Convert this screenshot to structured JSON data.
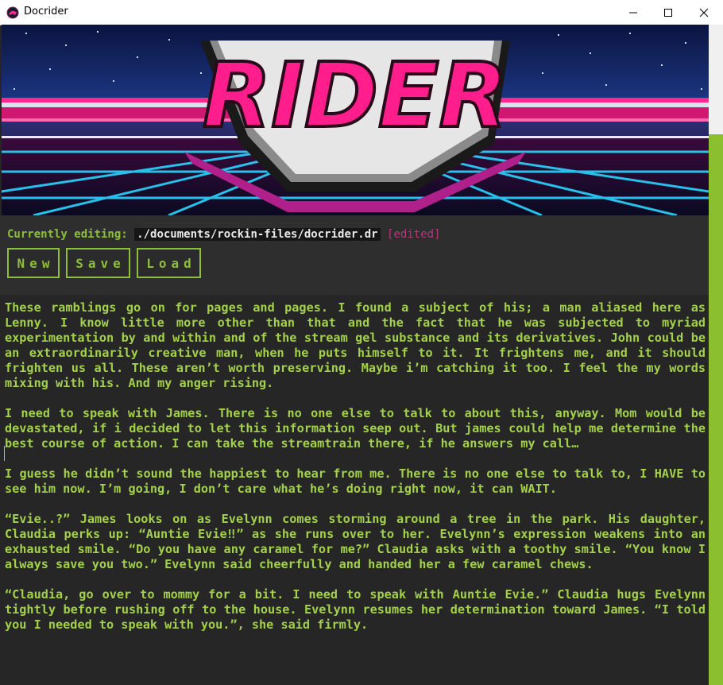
{
  "window": {
    "title": "Docrider",
    "app_icon": "docrider-logo-icon",
    "controls": [
      "minimize-icon",
      "maximize-icon",
      "close-icon"
    ]
  },
  "banner": {
    "logo_text": "RIDER",
    "colors": {
      "pink": "#ff1493",
      "cyan": "#2ad4ff",
      "navy": "#0a1a4a"
    }
  },
  "status": {
    "label": "Currently editing:",
    "path": "./documents/rockin-files/docrider.dr",
    "edited": "[edited]"
  },
  "toolbar": {
    "new_label": "New",
    "save_label": "Save",
    "load_label": "Load"
  },
  "editor": {
    "paragraphs": [
      "These ramblings go on for pages and pages. I found a subject of his; a man aliased here as Lenny. I know little more other than that and the fact that he was subjected to myriad experimentation by and within and of the stream gel substance and its derivatives. John could be an extraordinarily creative man, when he puts himself to it. It frightens me, and it should frighten us all. These aren’t worth preserving. Maybe i’m catching it too. I feel the my words mixing with his. And my anger rising.",
      "I need to speak with James. There is no one else to talk to about this, anyway. Mom would be devastated, if i decided to let this information seep out. But james could help me determine the best course of action. I can take the streamtrain there, if he answers my call…",
      "I guess he didn’t sound the happiest to hear from me. There is no one else to talk to, I HAVE to see him now. I’m going, I don’t care what he’s doing right now, it can WAIT.",
      "“Evie..?” James looks on as Evelynn comes storming around a tree in the park. His daughter, Claudia perks up: “Auntie Evie‼” as she runs over to her. Evelynn’s expression weakens into an exhausted smile. “Do you have any caramel for me?” Claudia asks with a toothy smile. “You know I always save you two.” Evelynn said cheerfully and handed her a few caramel chews.",
      "“Claudia, go over to mommy for a bit. I need to speak with Auntie Evie.” Claudia hugs Evelynn tightly before rushing off to the house. Evelynn resumes her determination toward James. “I told you I needed to speak with you.”, she said firmly."
    ]
  },
  "theme": {
    "accent": "#8ebf3a",
    "text": "#a3d14a",
    "edited": "#b23a7a",
    "background": "#262626"
  }
}
